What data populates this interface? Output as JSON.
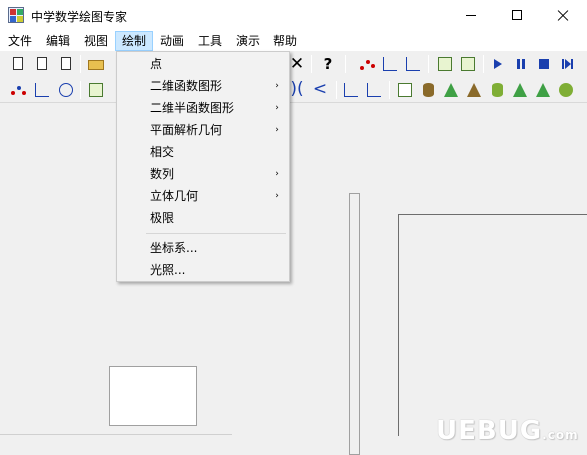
{
  "window": {
    "title": "中学数学绘图专家"
  },
  "menubar": {
    "items": [
      {
        "label": "文件"
      },
      {
        "label": "编辑"
      },
      {
        "label": "视图"
      },
      {
        "label": "绘制"
      },
      {
        "label": "动画"
      },
      {
        "label": "工具"
      },
      {
        "label": "演示"
      },
      {
        "label": "帮助"
      }
    ],
    "active_index": 3
  },
  "dropdown": {
    "items": [
      {
        "label": "点",
        "submenu": false
      },
      {
        "label": "二维函数图形",
        "submenu": true
      },
      {
        "label": "二维半函数图形",
        "submenu": true
      },
      {
        "label": "平面解析几何",
        "submenu": true
      },
      {
        "label": "相交",
        "submenu": false
      },
      {
        "label": "数列",
        "submenu": true
      },
      {
        "label": "立体几何",
        "submenu": true
      },
      {
        "label": "极限",
        "submenu": false
      },
      {
        "label": "坐标系...",
        "submenu": false
      },
      {
        "label": "光照...",
        "submenu": false
      }
    ],
    "submenu_arrow": "›"
  },
  "toolbar1": {
    "icons": [
      "new-doc-icon",
      "new-doc2-icon",
      "copy-doc-icon",
      "open-folder-icon",
      "delete-x-icon",
      "help-icon",
      "point-plot-icon",
      "axes-plot-icon",
      "graph-icon",
      "graph2-icon",
      "play-icon",
      "pause-icon",
      "stop-icon",
      "skip-end-icon"
    ],
    "help_glyph": "?",
    "delete_glyph": "✕"
  },
  "toolbar2": {
    "icons": [
      "points-icon",
      "axes-icon",
      "circle-icon",
      "graph-icon",
      "paren-icon",
      "angle-icon",
      "axes3d-icon",
      "axes3d-2-icon",
      "box-icon",
      "cylinder-icon",
      "cone-icon",
      "frustum-icon",
      "cylinder2-icon",
      "cone2-icon",
      "frustum2-icon",
      "sphere-icon"
    ],
    "paren_glyph": ")(",
    "angle_glyph": "<"
  },
  "watermark": {
    "text": "UEBUG",
    "suffix": ".com"
  },
  "colors": {
    "accent": "#1a3fae",
    "menu_highlight": "#cce8ff",
    "solid_green": "#7fae35"
  }
}
